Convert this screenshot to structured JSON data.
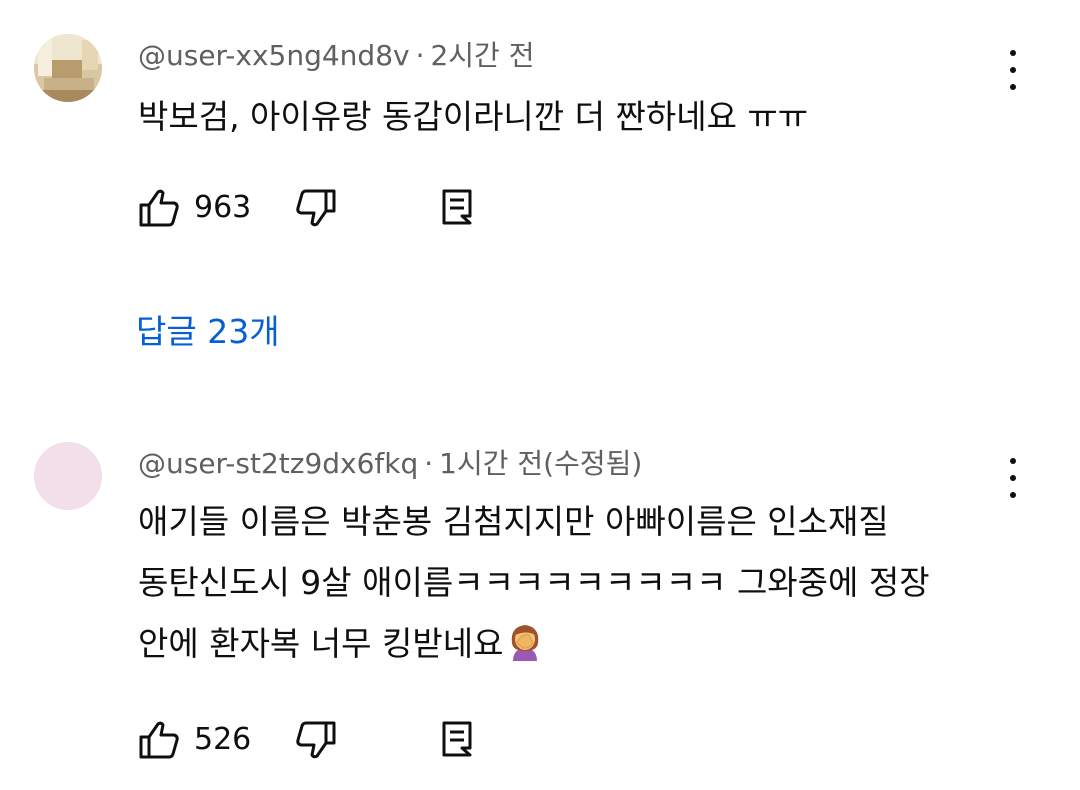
{
  "comments": [
    {
      "username": "@user-xx5ng4nd8v",
      "separator": "·",
      "time": "2시간 전",
      "text_lines": [
        "박보검, 아이유랑 동갑이라니깐 더 짠하네요 ㅠㅠ"
      ],
      "likes": "963",
      "replies_label": "답글 23개",
      "avatar": "room-photo-avatar"
    },
    {
      "username": "@user-st2tz9dx6fkq",
      "separator": "·",
      "time": "1시간 전(수정됨)",
      "text_lines": [
        "애기들 이름은 박춘봉 김첨지지만 아빠이름은 인소재질",
        "동탄신도시 9살 애이름ㅋㅋㅋㅋㅋㅋㅋㅋㅋ 그와중에 정장",
        "안에 환자복 너무 킹받네요"
      ],
      "emoji": "face-palm-emoji",
      "likes": "526",
      "avatar": "pink-circle-avatar"
    }
  ],
  "colors": {
    "text": "#0f0f0f",
    "meta": "#606060",
    "link": "#065fd4",
    "avatar_pink": "#f3dfe9"
  }
}
